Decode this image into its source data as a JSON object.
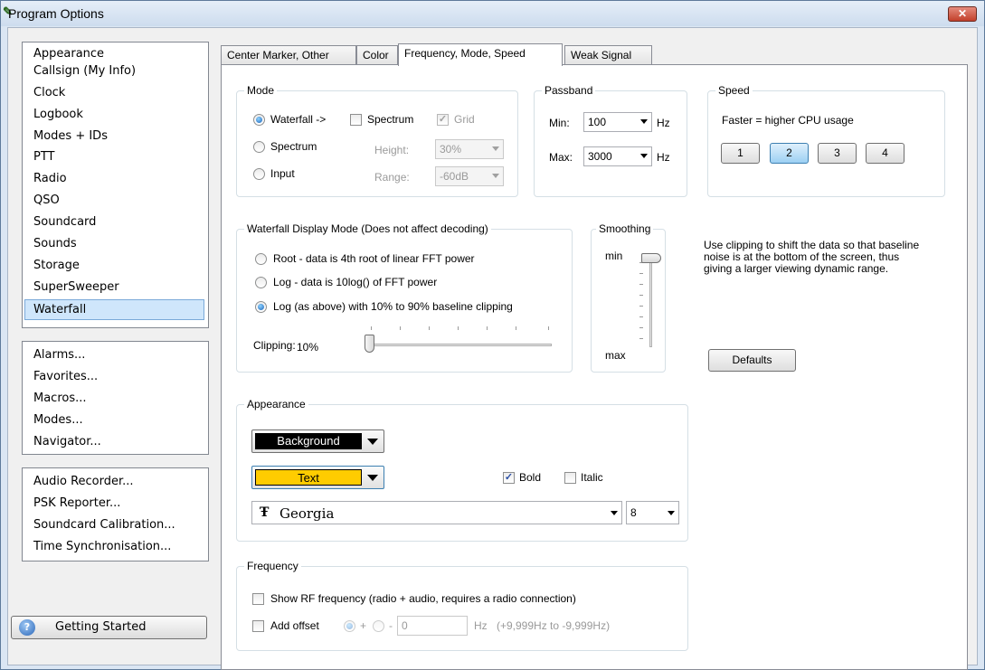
{
  "window": {
    "title": "Program Options",
    "close_glyph": "✕"
  },
  "sidebar": {
    "group1": [
      "Appearance",
      "Callsign (My Info)",
      "Clock",
      "Logbook",
      "Modes + IDs",
      "PTT",
      "Radio",
      "QSO",
      "Soundcard",
      "Sounds",
      "Storage",
      "SuperSweeper",
      "Waterfall"
    ],
    "selected": "Waterfall",
    "group2": [
      "Alarms...",
      "Favorites...",
      "Macros...",
      "Modes...",
      "Navigator..."
    ],
    "group3": [
      "Audio Recorder...",
      "PSK Reporter...",
      "Soundcard Calibration...",
      "Time Synchronisation..."
    ],
    "getting_started": "Getting Started",
    "getting_started_icon": "help-icon"
  },
  "tabs": [
    "Center Marker, Other",
    "Color",
    "Frequency, Mode, Speed",
    "Weak Signal"
  ],
  "active_tab": "Frequency, Mode, Speed",
  "mode": {
    "title": "Mode",
    "waterfall": "Waterfall ->",
    "spectrum_check": "Spectrum",
    "grid": "Grid",
    "spectrum": "Spectrum",
    "height_label": "Height:",
    "height_value": "30%",
    "input": "Input",
    "range_label": "Range:",
    "range_value": "-60dB"
  },
  "passband": {
    "title": "Passband",
    "min_label": "Min:",
    "min_value": "100",
    "max_label": "Max:",
    "max_value": "3000",
    "unit": "Hz"
  },
  "speed": {
    "title": "Speed",
    "note": "Faster = higher CPU usage",
    "buttons": [
      "1",
      "2",
      "3",
      "4"
    ],
    "selected": "2"
  },
  "waterfall_display": {
    "title": "Waterfall Display Mode (Does not affect decoding)",
    "root": "Root - data is 4th root of linear FFT power",
    "log": "Log - data is 10log() of FFT power",
    "log_clip": "Log (as above) with 10% to 90% baseline clipping",
    "clipping_label": "Clipping:",
    "clipping_value": "10%",
    "clipping_level": 0
  },
  "smoothing": {
    "title": "Smoothing",
    "min": "min",
    "max": "max",
    "level": 0
  },
  "clipping_note": "Use clipping to shift the data so that baseline noise is at the bottom of the screen, thus giving a larger viewing dynamic range.",
  "defaults_button": "Defaults",
  "appearance": {
    "title": "Appearance",
    "background_label": "Background",
    "background_color": "#000000",
    "text_label": "Text",
    "text_color": "#ffd700",
    "bold": "Bold",
    "italic": "Italic",
    "font_icon": "truetype-font-icon",
    "font_name": "Georgia",
    "font_size": "8"
  },
  "frequency": {
    "title": "Frequency",
    "show_rf": "Show RF frequency (radio + audio, requires a radio connection)",
    "add_offset": "Add offset",
    "plus": "+",
    "minus": "-",
    "offset_value": "0",
    "unit": "Hz",
    "range_note": "(+9,999Hz to -9,999Hz)"
  }
}
